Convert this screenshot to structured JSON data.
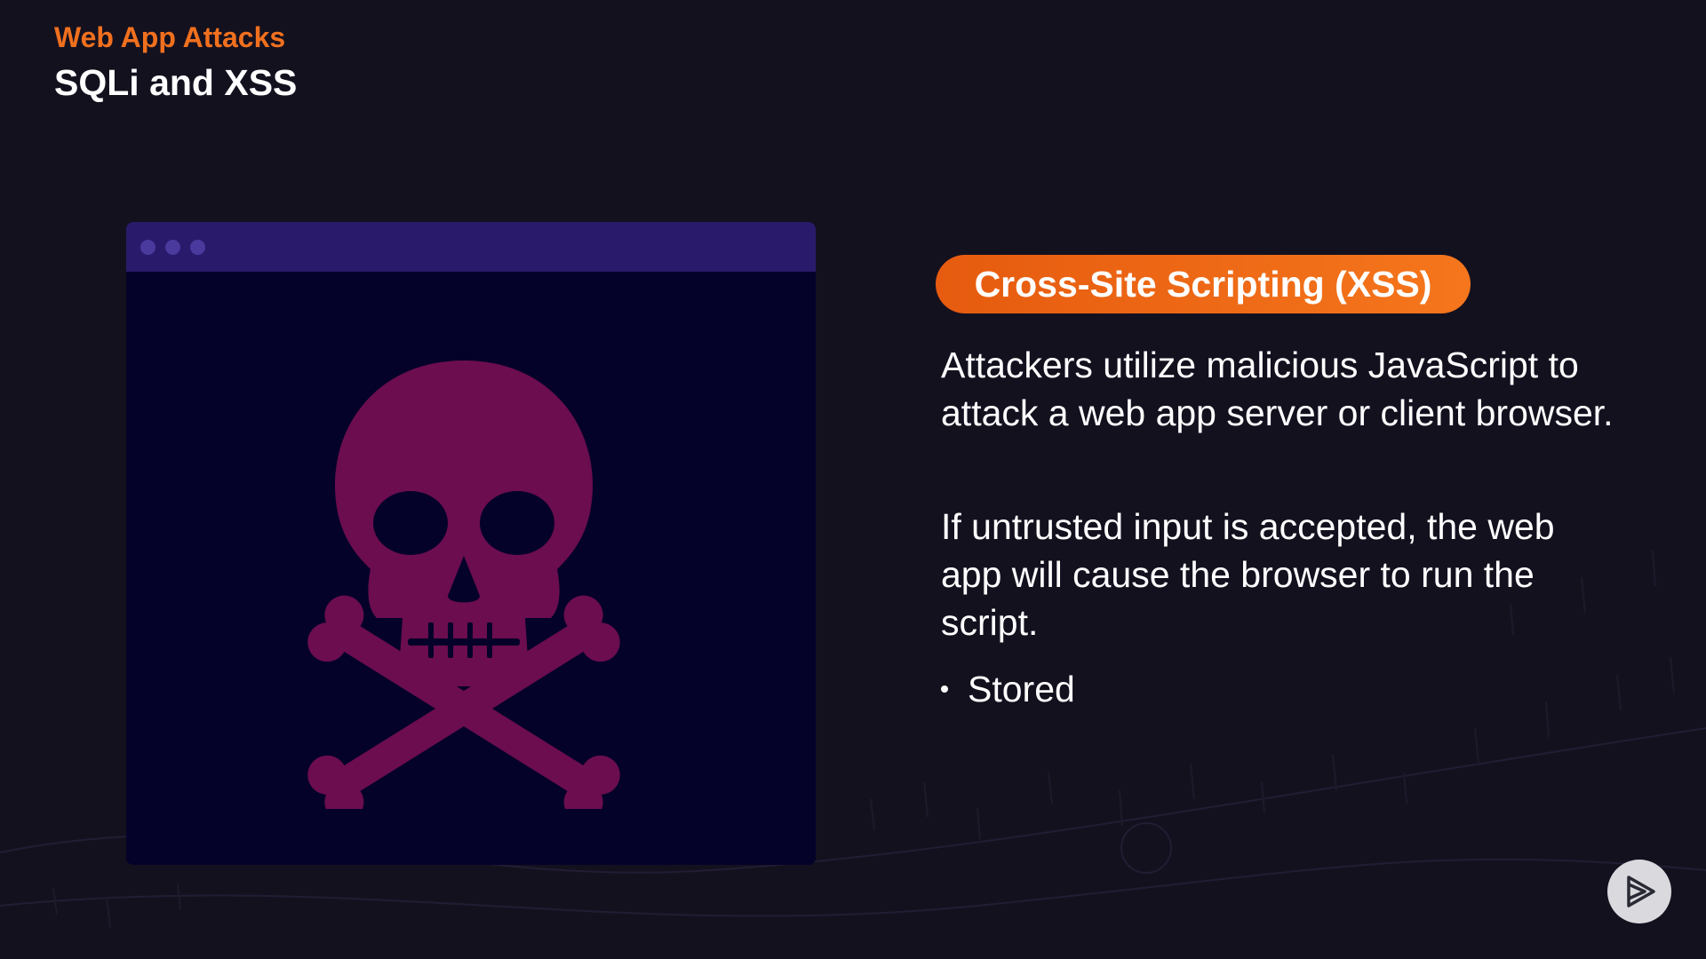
{
  "header": {
    "eyebrow": "Web App Attacks",
    "title": "SQLi and XSS"
  },
  "illustration": {
    "icon": "skull-crossbones-icon",
    "window_dots": 3
  },
  "content": {
    "pill_label": "Cross-Site Scripting (XSS)",
    "paragraph_1": "Attackers utilize malicious JavaScript to attack a web app  server or client browser.",
    "paragraph_2": "If untrusted input is accepted, the web app will cause the browser to run the script.",
    "bullets": [
      "Stored"
    ]
  },
  "brand": {
    "logo_icon": "play-logo-icon"
  },
  "colors": {
    "accent": "#f0701e",
    "background": "#14111f",
    "window_bar": "#2a1a6b",
    "window_body": "#05022a",
    "skull": "#6b0d4e"
  }
}
